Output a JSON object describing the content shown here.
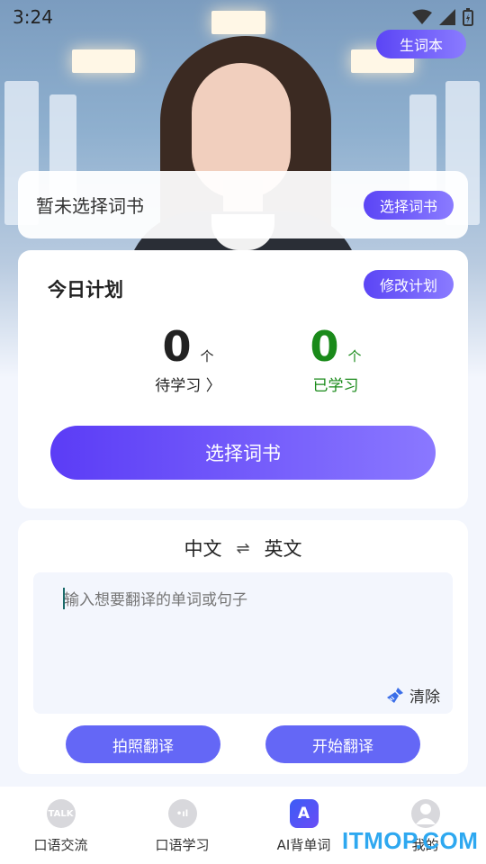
{
  "status_bar": {
    "time": "3:24"
  },
  "header": {
    "wordbook_label": "生词本"
  },
  "book_card": {
    "label": "暂未选择词书",
    "select_label": "选择词书"
  },
  "plan": {
    "title": "今日计划",
    "edit_label": "修改计划",
    "pending": {
      "count": "0",
      "unit": "个",
      "label": "待学习 〉"
    },
    "done": {
      "count": "0",
      "unit": "个",
      "label": "已学习"
    },
    "select_book_label": "选择词书"
  },
  "translate": {
    "source_lang": "中文",
    "swap_symbol": "⇌",
    "target_lang": "英文",
    "input_placeholder": "输入想要翻译的单词或句子",
    "clear_label": "清除",
    "photo_label": "拍照翻译",
    "start_label": "开始翻译"
  },
  "tabbar": {
    "items": [
      {
        "label": "口语交流",
        "icon": "talk-icon",
        "icon_text": "TALK"
      },
      {
        "label": "口语学习",
        "icon": "audio-icon",
        "icon_text": "•ıl"
      },
      {
        "label": "AI背单词",
        "icon": "ai-words-icon",
        "icon_text": "A"
      },
      {
        "label": "我的",
        "icon": "profile-icon",
        "icon_text": ""
      }
    ]
  },
  "watermark": {
    "text": "ITMOP.COM"
  },
  "colors": {
    "accent": "#5b45f5",
    "done_green": "#1a8a1a",
    "button_blue": "#6467f6"
  }
}
